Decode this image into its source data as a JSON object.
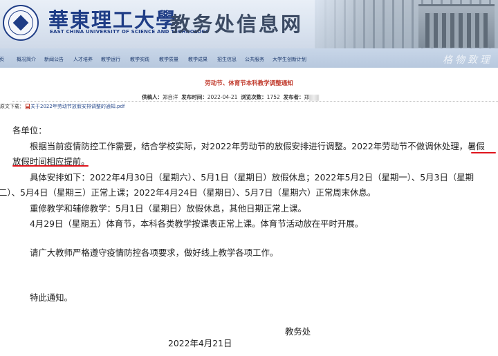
{
  "header": {
    "school_name_cn": "華東理工大學",
    "school_name_en": "EAST CHINA UNIVERSITY OF SCIENCE AND TECHNOLOGY",
    "site_title": "教务处信息网",
    "motto_watermark": "格物致理"
  },
  "nav": {
    "items": [
      "首页",
      "概况简介",
      "新闻公告",
      "人才培养",
      "教学运行",
      "教学实践",
      "教学质量",
      "教学成果",
      "招生信息",
      "公共服务",
      "大学生创新计划"
    ]
  },
  "article": {
    "title": "劳动节、体育节本科教学调整通知",
    "meta": {
      "author_label": "供稿人：",
      "author": "郑自洋",
      "date_label": "发布时间：",
      "date": "2022-04-21",
      "views_label": "浏览次数：",
      "views": "1752",
      "publisher_label": "发布者：",
      "publisher_partial": "郑"
    },
    "attachment_label": "原文下载：",
    "attachment_name": "关于2022年劳动节放假安排调整的通知.pdf",
    "greeting": "各单位：",
    "para1_line1_a": "根据当前疫情防控工作需要，结合学校实际，对2022年劳动节的放假安排进行调整。2022年劳动节不做调休处理，",
    "para1_line1_b": "暑假",
    "para1_line2": "放假时间相应提前。",
    "para2_line1": "具体安排如下：2022年4月30日（星期六）、5月1日（星期日）放假休息；2022年5月2日（星期一）、5月3日（星期",
    "para2_line2": "二）、5月4日（星期三）正常上课；2022年4月24日（星期日）、5月7日（星期六）正常周末休息。",
    "para3": "重修教学和辅修教学：5月1日（星期日）放假休息，其他日期正常上课。",
    "para4": "4月29日（星期五）体育节，本科各类教学按课表正常上课。体育节活动放在平时开展。",
    "para5": "请广大教师严格遵守疫情防控各项要求，做好线上教学各项工作。",
    "closing": "特此通知。",
    "signature": "教务处",
    "sign_date": "2022年4月21日"
  },
  "colors": {
    "accent_red": "#e0141c",
    "title_red": "#c0392b",
    "brand_blue": "#1f3d86"
  }
}
